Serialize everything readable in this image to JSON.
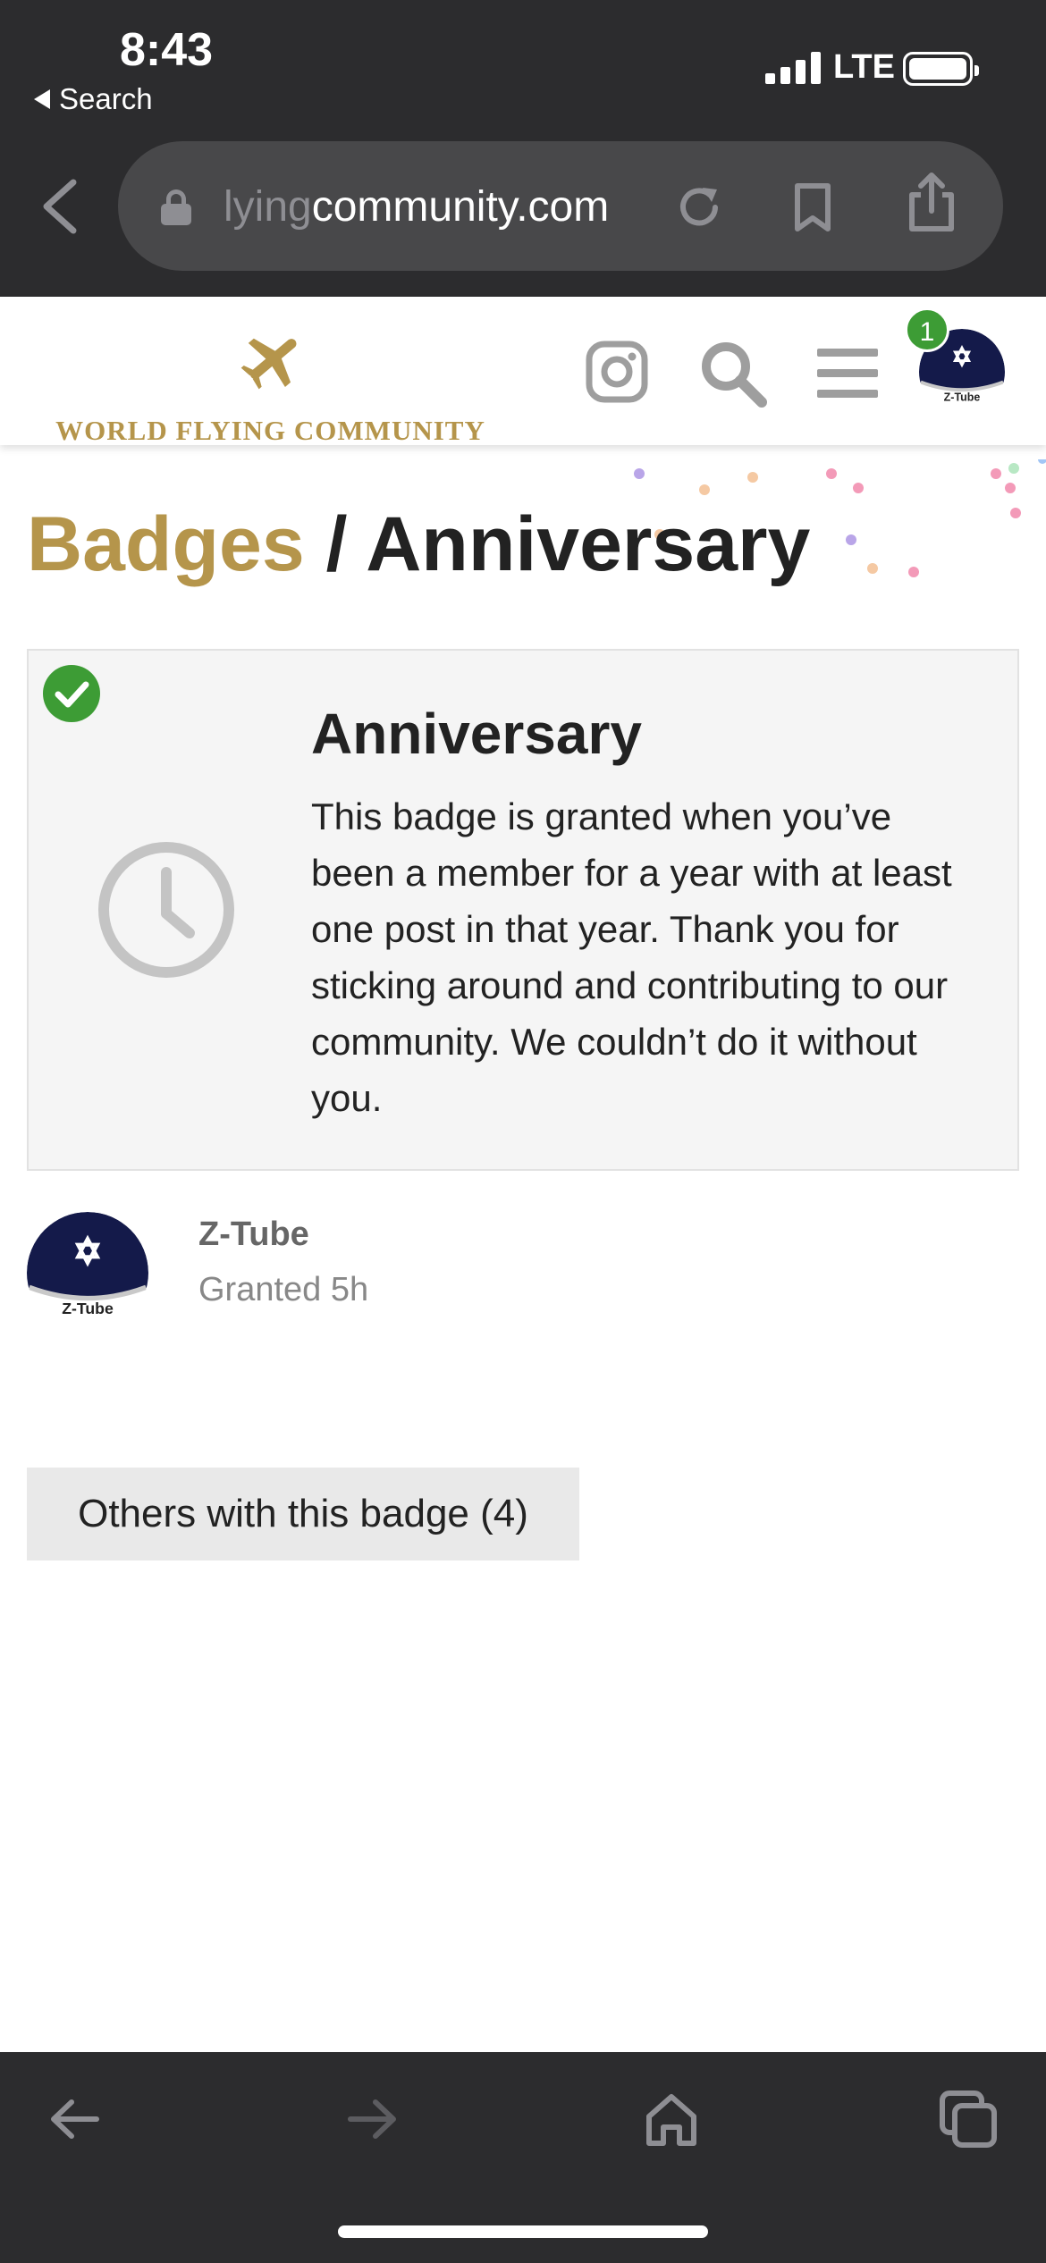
{
  "status_bar": {
    "time": "8:43",
    "back_app_label": "Search",
    "network": "LTE"
  },
  "browser": {
    "url_faded": "lying",
    "url_main": "community.com",
    "icons": [
      "back-chevron-icon",
      "lock-icon",
      "reload-icon",
      "bookmark-icon",
      "share-icon"
    ]
  },
  "site_header": {
    "logo_text": "WORLD FLYING COMMUNITY",
    "notification_count": "1",
    "brand_color": "#b5954b",
    "icons": [
      "instagram-icon",
      "search-icon",
      "menu-icon",
      "user-avatar"
    ]
  },
  "page": {
    "breadcrumb_parent": "Badges",
    "separator": "/",
    "title": "Anniversary"
  },
  "badge": {
    "name": "Anniversary",
    "description": "This badge is granted when you’ve been a member for a year with at least one post in that year. Thank you for sticking around and contributing to our community. We couldn’t do it without you.",
    "granted_color": "#3d9c35",
    "icon": "clock-icon"
  },
  "granted_user": {
    "name": "Z-Tube",
    "granted": "Granted 5h",
    "avatar_text": "Z-Tube"
  },
  "others_button": {
    "label": "Others with this badge (4)"
  },
  "toolbar": {
    "icons": [
      "back-arrow-icon",
      "forward-arrow-icon",
      "home-icon",
      "tabs-icon"
    ]
  }
}
